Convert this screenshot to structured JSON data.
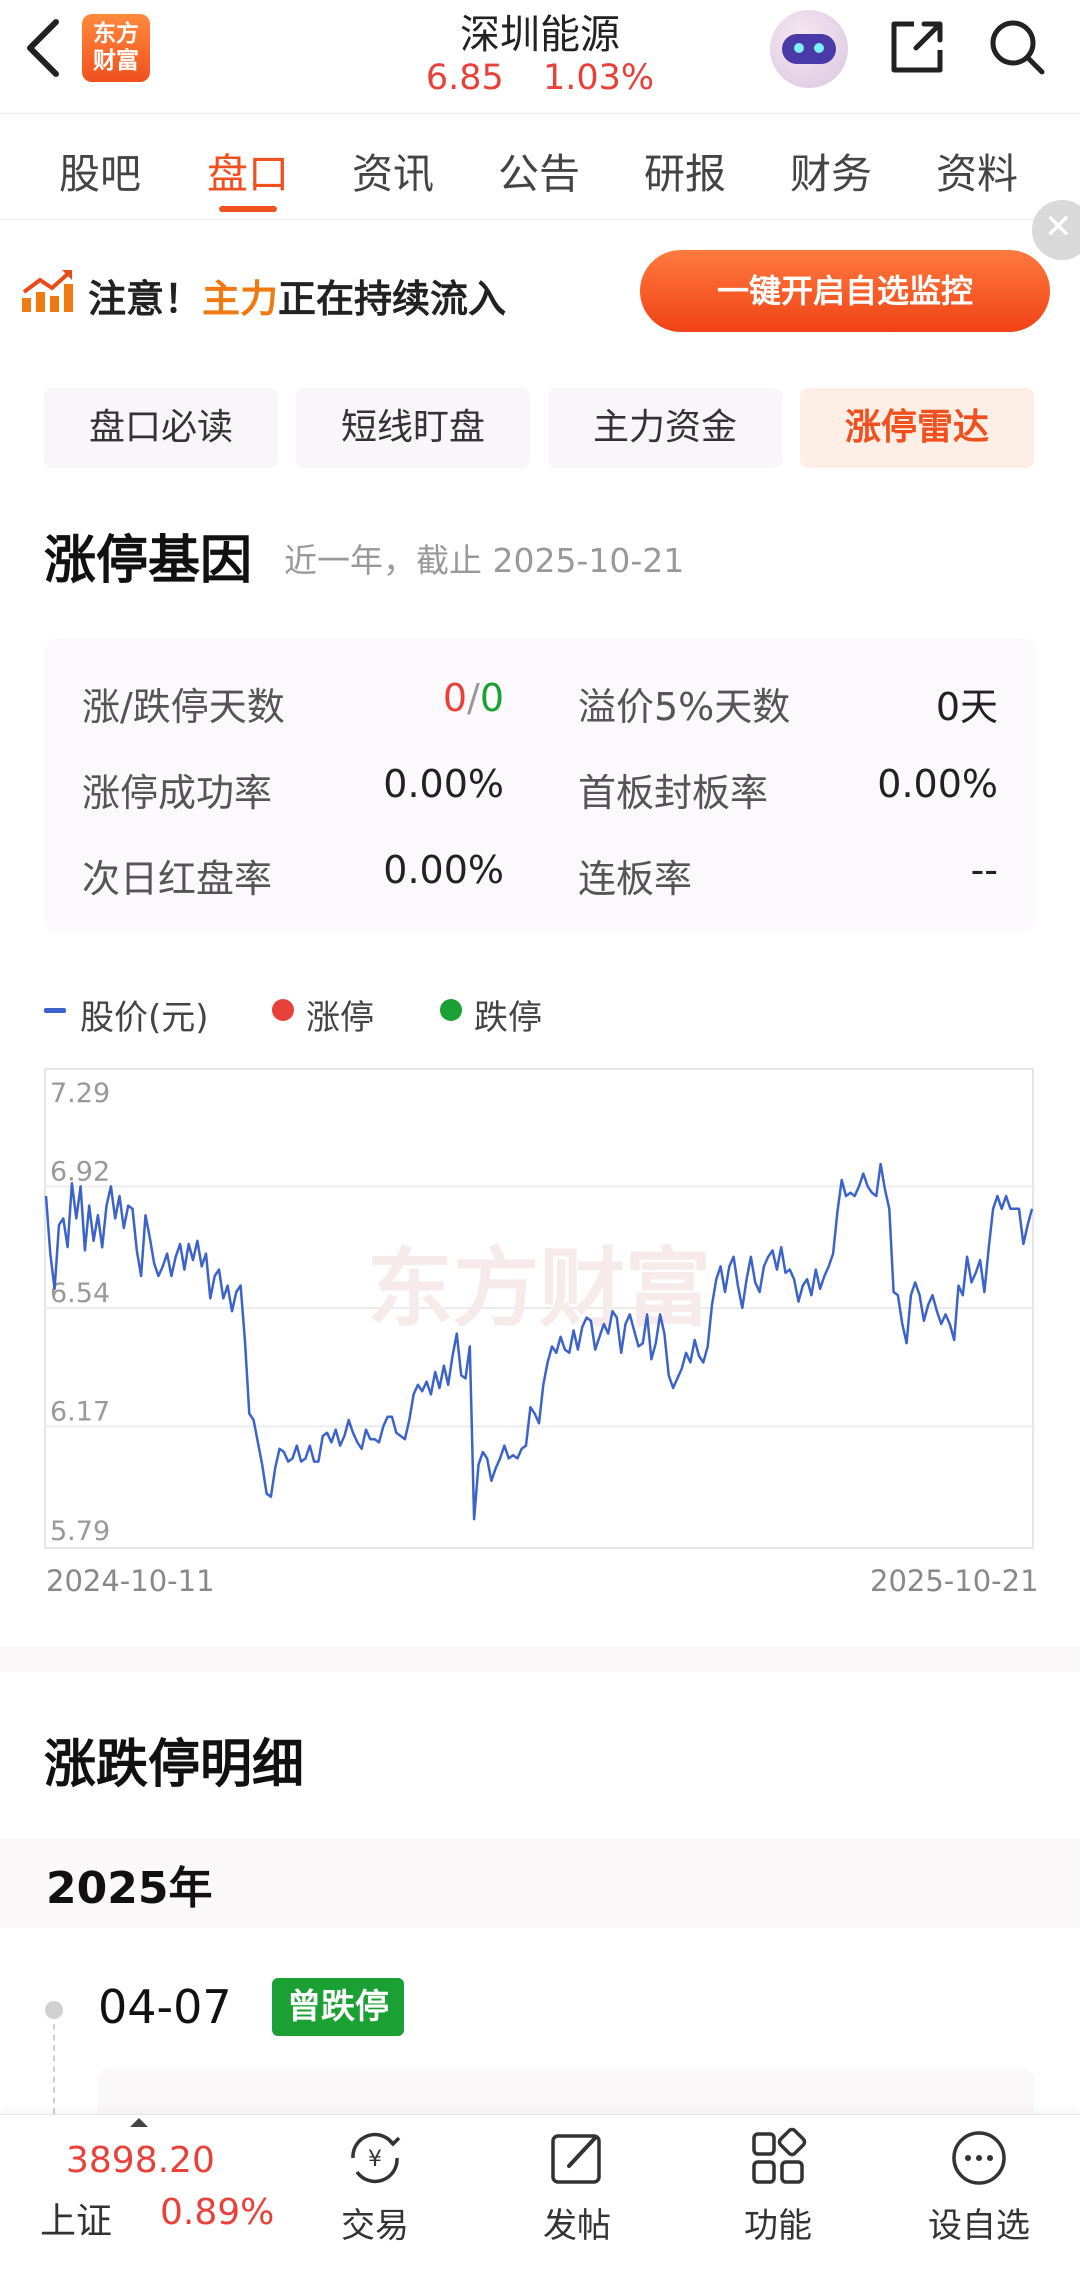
{
  "header": {
    "logo_text": "东方财富",
    "stock_name": "深圳能源",
    "price": "6.85",
    "change_pct": "1.03%"
  },
  "tabs": [
    {
      "label": "股吧",
      "active": false
    },
    {
      "label": "盘口",
      "active": true
    },
    {
      "label": "资讯",
      "active": false
    },
    {
      "label": "公告",
      "active": false
    },
    {
      "label": "研报",
      "active": false
    },
    {
      "label": "财务",
      "active": false
    },
    {
      "label": "资料",
      "active": false
    }
  ],
  "banner": {
    "text_prefix": "注意！",
    "text_highlight": "主力",
    "text_suffix": "正在持续流入",
    "button_label": "一键开启自选监控"
  },
  "subtabs": [
    {
      "label": "盘口必读",
      "active": false
    },
    {
      "label": "短线盯盘",
      "active": false
    },
    {
      "label": "主力资金",
      "active": false
    },
    {
      "label": "涨停雷达",
      "active": true
    }
  ],
  "gene": {
    "title": "涨停基因",
    "subtitle": "近一年，截止 2025-10-21",
    "stats": {
      "limit_days_label": "涨/跌停天数",
      "limit_up_days": "0",
      "separator": "/",
      "limit_down_days": "0",
      "premium_label": "溢价5%天数",
      "premium_value": "0天",
      "success_label": "涨停成功率",
      "success_value": "0.00%",
      "first_board_label": "首板封板率",
      "first_board_value": "0.00%",
      "next_red_label": "次日红盘率",
      "next_red_value": "0.00%",
      "consecutive_label": "连板率",
      "consecutive_value": "--"
    }
  },
  "legend": {
    "price_label": "股价(元)",
    "up_label": "涨停",
    "down_label": "跌停"
  },
  "colors": {
    "accent": "#f0501e",
    "up": "#e8413a",
    "down": "#1aa033",
    "line": "#3b63c9"
  },
  "chart_data": {
    "type": "line",
    "ylim": [
      5.79,
      7.29
    ],
    "y_ticks": [
      "7.29",
      "6.92",
      "6.54",
      "6.17",
      "5.79"
    ],
    "x_start": "2024-10-11",
    "x_end": "2025-10-21",
    "watermark": "东方财富",
    "series": [
      {
        "name": "股价(元)",
        "values": [
          6.89,
          6.71,
          6.6,
          6.8,
          6.82,
          6.73,
          6.93,
          6.82,
          6.92,
          6.72,
          6.86,
          6.75,
          6.83,
          6.73,
          6.86,
          6.92,
          6.82,
          6.89,
          6.79,
          6.86,
          6.85,
          6.72,
          6.64,
          6.83,
          6.76,
          6.68,
          6.64,
          6.67,
          6.71,
          6.64,
          6.7,
          6.74,
          6.66,
          6.74,
          6.69,
          6.75,
          6.67,
          6.71,
          6.57,
          6.64,
          6.66,
          6.57,
          6.61,
          6.53,
          6.59,
          6.61,
          6.44,
          6.21,
          6.19,
          6.12,
          6.05,
          5.96,
          5.95,
          6.04,
          6.1,
          6.09,
          6.06,
          6.07,
          6.11,
          6.06,
          6.07,
          6.11,
          6.06,
          6.06,
          6.14,
          6.15,
          6.12,
          6.16,
          6.11,
          6.14,
          6.19,
          6.15,
          6.12,
          6.1,
          6.16,
          6.13,
          6.13,
          6.12,
          6.17,
          6.2,
          6.2,
          6.15,
          6.14,
          6.13,
          6.19,
          6.27,
          6.3,
          6.28,
          6.31,
          6.27,
          6.34,
          6.29,
          6.36,
          6.3,
          6.39,
          6.46,
          6.33,
          6.32,
          6.42,
          5.88,
          6.05,
          6.09,
          6.07,
          6.0,
          6.04,
          6.07,
          6.11,
          6.07,
          6.08,
          6.07,
          6.1,
          6.11,
          6.23,
          6.21,
          6.18,
          6.3,
          6.37,
          6.42,
          6.4,
          6.45,
          6.41,
          6.4,
          6.47,
          6.41,
          6.48,
          6.51,
          6.5,
          6.41,
          6.45,
          6.49,
          6.46,
          6.53,
          6.51,
          6.4,
          6.49,
          6.52,
          6.47,
          6.42,
          6.43,
          6.52,
          6.38,
          6.43,
          6.52,
          6.46,
          6.33,
          6.29,
          6.32,
          6.35,
          6.4,
          6.37,
          6.44,
          6.39,
          6.37,
          6.42,
          6.55,
          6.63,
          6.67,
          6.59,
          6.67,
          6.7,
          6.61,
          6.54,
          6.63,
          6.7,
          6.62,
          6.59,
          6.67,
          6.7,
          6.72,
          6.66,
          6.73,
          6.65,
          6.66,
          6.63,
          6.56,
          6.61,
          6.63,
          6.58,
          6.66,
          6.6,
          6.64,
          6.67,
          6.71,
          6.84,
          6.94,
          6.89,
          6.9,
          6.89,
          6.92,
          6.96,
          6.92,
          6.9,
          6.89,
          6.99,
          6.91,
          6.85,
          6.59,
          6.58,
          6.49,
          6.43,
          6.58,
          6.62,
          6.58,
          6.5,
          6.55,
          6.58,
          6.53,
          6.49,
          6.52,
          6.49,
          6.44,
          6.61,
          6.58,
          6.7,
          6.62,
          6.65,
          6.69,
          6.59,
          6.73,
          6.85,
          6.89,
          6.85,
          6.89,
          6.85,
          6.85,
          6.85,
          6.74,
          6.8,
          6.85
        ]
      }
    ],
    "limit_up_points": [],
    "limit_down_points": []
  },
  "chart_watermark": "东方财富",
  "detail": {
    "title": "涨跌停明细",
    "year": "2025年",
    "events": [
      {
        "date": "04-07",
        "badge": "曾跌停"
      }
    ]
  },
  "bottom": {
    "index_value": "3898.20",
    "index_name": "上证",
    "index_pct": "0.89%",
    "nav": [
      {
        "label": "交易",
        "icon": "yen-exchange-icon"
      },
      {
        "label": "发帖",
        "icon": "edit-icon"
      },
      {
        "label": "功能",
        "icon": "apps-icon"
      },
      {
        "label": "设自选",
        "icon": "more-circle-icon"
      }
    ]
  }
}
